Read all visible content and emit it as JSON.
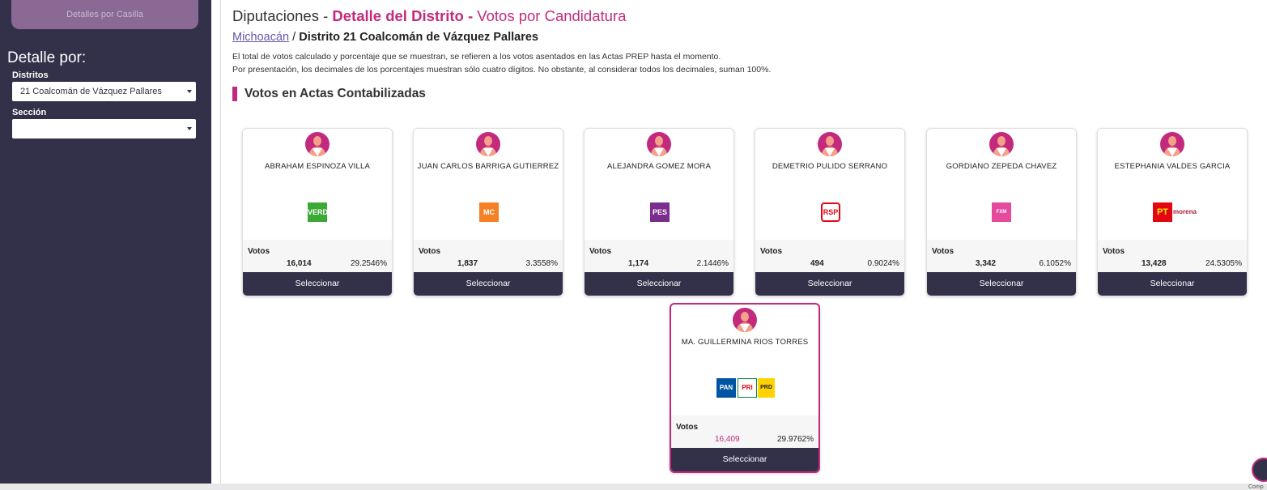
{
  "sidebar": {
    "top_button": "Detalles por Casilla",
    "detalle_title": "Detalle por:",
    "distritos_label": "Distritos",
    "distritos_value": "21 Coalcomán de Vázquez Pallares",
    "seccion_label": "Sección",
    "seccion_value": ""
  },
  "header": {
    "part1": "Diputaciones - ",
    "part2": "Detalle del Distrito - ",
    "part3": "Votos por Candidatura"
  },
  "breadcrumb": {
    "link": "Michoacán",
    "sep": " / ",
    "current": "Distrito 21 Coalcomán de Vázquez Pallares"
  },
  "notes": {
    "line1": "El total de votos calculado y porcentaje que se muestran, se refieren a los votos asentados en las Actas PREP hasta el momento.",
    "line2": "Por presentación, los decimales de los porcentajes muestran sólo cuatro dígitos. No obstante, al considerar todos los decimales, suman 100%."
  },
  "section_title": "Votos en Actas Contabilizadas",
  "votes_label": "Votos",
  "select_label": "Seleccionar",
  "share_label": "Comp",
  "candidates": [
    {
      "name": "ABRAHAM ESPINOZA VILLA",
      "party": "VERDE",
      "votes": "16,014",
      "pct": "29.2546%",
      "color": "#3aa935"
    },
    {
      "name": "JUAN CARLOS BARRIGA GUTIERREZ",
      "party": "MC",
      "votes": "1,837",
      "pct": "3.3558%",
      "color": "#f58025"
    },
    {
      "name": "ALEJANDRA GOMEZ MORA",
      "party": "PES",
      "votes": "1,174",
      "pct": "2.1446%",
      "color": "#7b2d8e"
    },
    {
      "name": "DEMETRIO PULIDO SERRANO",
      "party": "RSP",
      "votes": "494",
      "pct": "0.9024%",
      "color": "#e30613"
    },
    {
      "name": "GORDIANO ZEPEDA CHAVEZ",
      "party": "FXM",
      "votes": "3,342",
      "pct": "6.1052%",
      "color": "#e54a9d"
    },
    {
      "name": "ESTEPHANIA VALDES GARCIA",
      "party": "PT",
      "party2": "morena",
      "votes": "13,428",
      "pct": "24.5305%",
      "color": "#e30613"
    },
    {
      "name": "MA. GUILLERMINA RIOS TORRES",
      "party": "PAN",
      "party2": "PRI",
      "party3": "PRD",
      "votes": "16,409",
      "pct": "29.9762%",
      "color": "#0054a4"
    }
  ]
}
